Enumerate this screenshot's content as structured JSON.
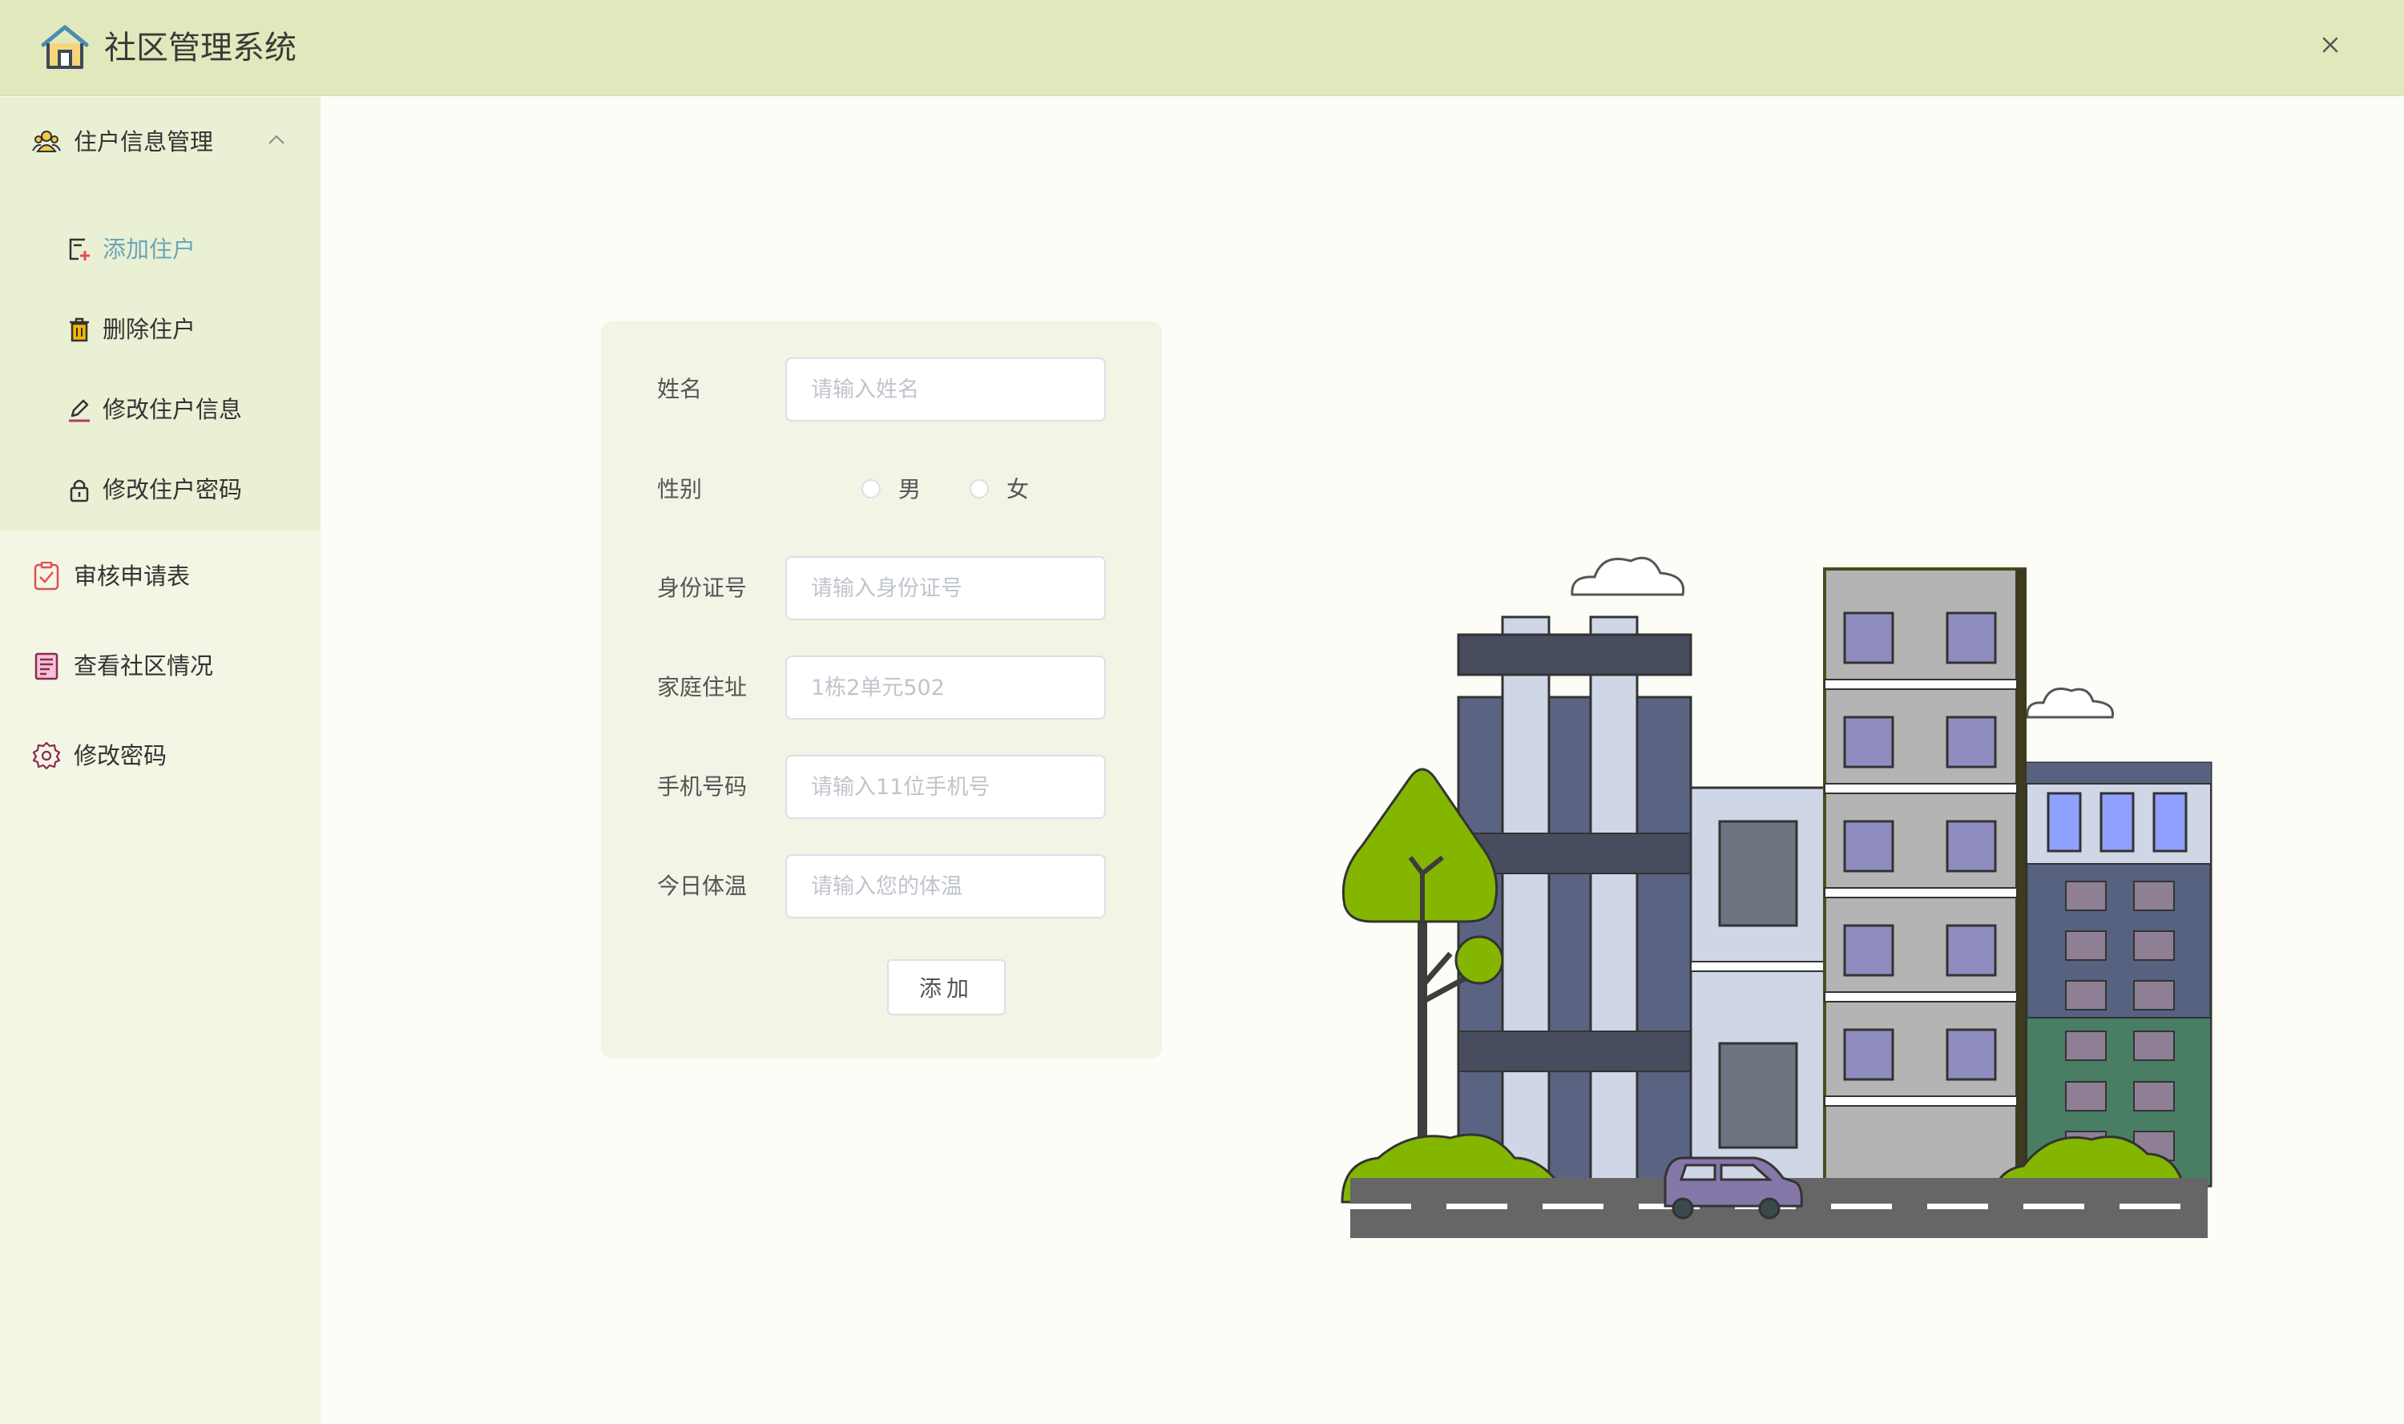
{
  "header": {
    "title": "社区管理系统",
    "logo_icon": "house-icon",
    "close_icon": "close-icon"
  },
  "sidebar": {
    "groups": [
      {
        "label": "住户信息管理",
        "icon": "users-icon",
        "expanded": true,
        "children": [
          {
            "label": "添加住户",
            "icon": "add-form-icon",
            "active": true
          },
          {
            "label": "删除住户",
            "icon": "trash-icon",
            "active": false
          },
          {
            "label": "修改住户信息",
            "icon": "edit-icon",
            "active": false
          },
          {
            "label": "修改住户密码",
            "icon": "lock-icon",
            "active": false
          }
        ]
      },
      {
        "label": "审核申请表",
        "icon": "checklist-icon"
      },
      {
        "label": "查看社区情况",
        "icon": "report-icon"
      },
      {
        "label": "修改密码",
        "icon": "gear-icon"
      }
    ]
  },
  "form": {
    "name": {
      "label": "姓名",
      "placeholder": "请输入姓名",
      "value": ""
    },
    "gender": {
      "label": "性别",
      "options": [
        "男",
        "女"
      ],
      "selected": null
    },
    "id_number": {
      "label": "身份证号",
      "placeholder": "请输入身份证号",
      "value": ""
    },
    "address": {
      "label": "家庭住址",
      "placeholder": "1栋2单元502",
      "value": ""
    },
    "phone": {
      "label": "手机号码",
      "placeholder": "请输入11位手机号",
      "value": ""
    },
    "temperature": {
      "label": "今日体温",
      "placeholder": "请输入您的体温",
      "value": ""
    },
    "submit_label": "添加"
  },
  "colors": {
    "header_bg": "#e1e9bc",
    "sidebar_bg": "#f3f6e4",
    "active_text": "#6aa6b9",
    "page_bg": "#fcfdf7",
    "card_bg": "#f2f4e6"
  }
}
